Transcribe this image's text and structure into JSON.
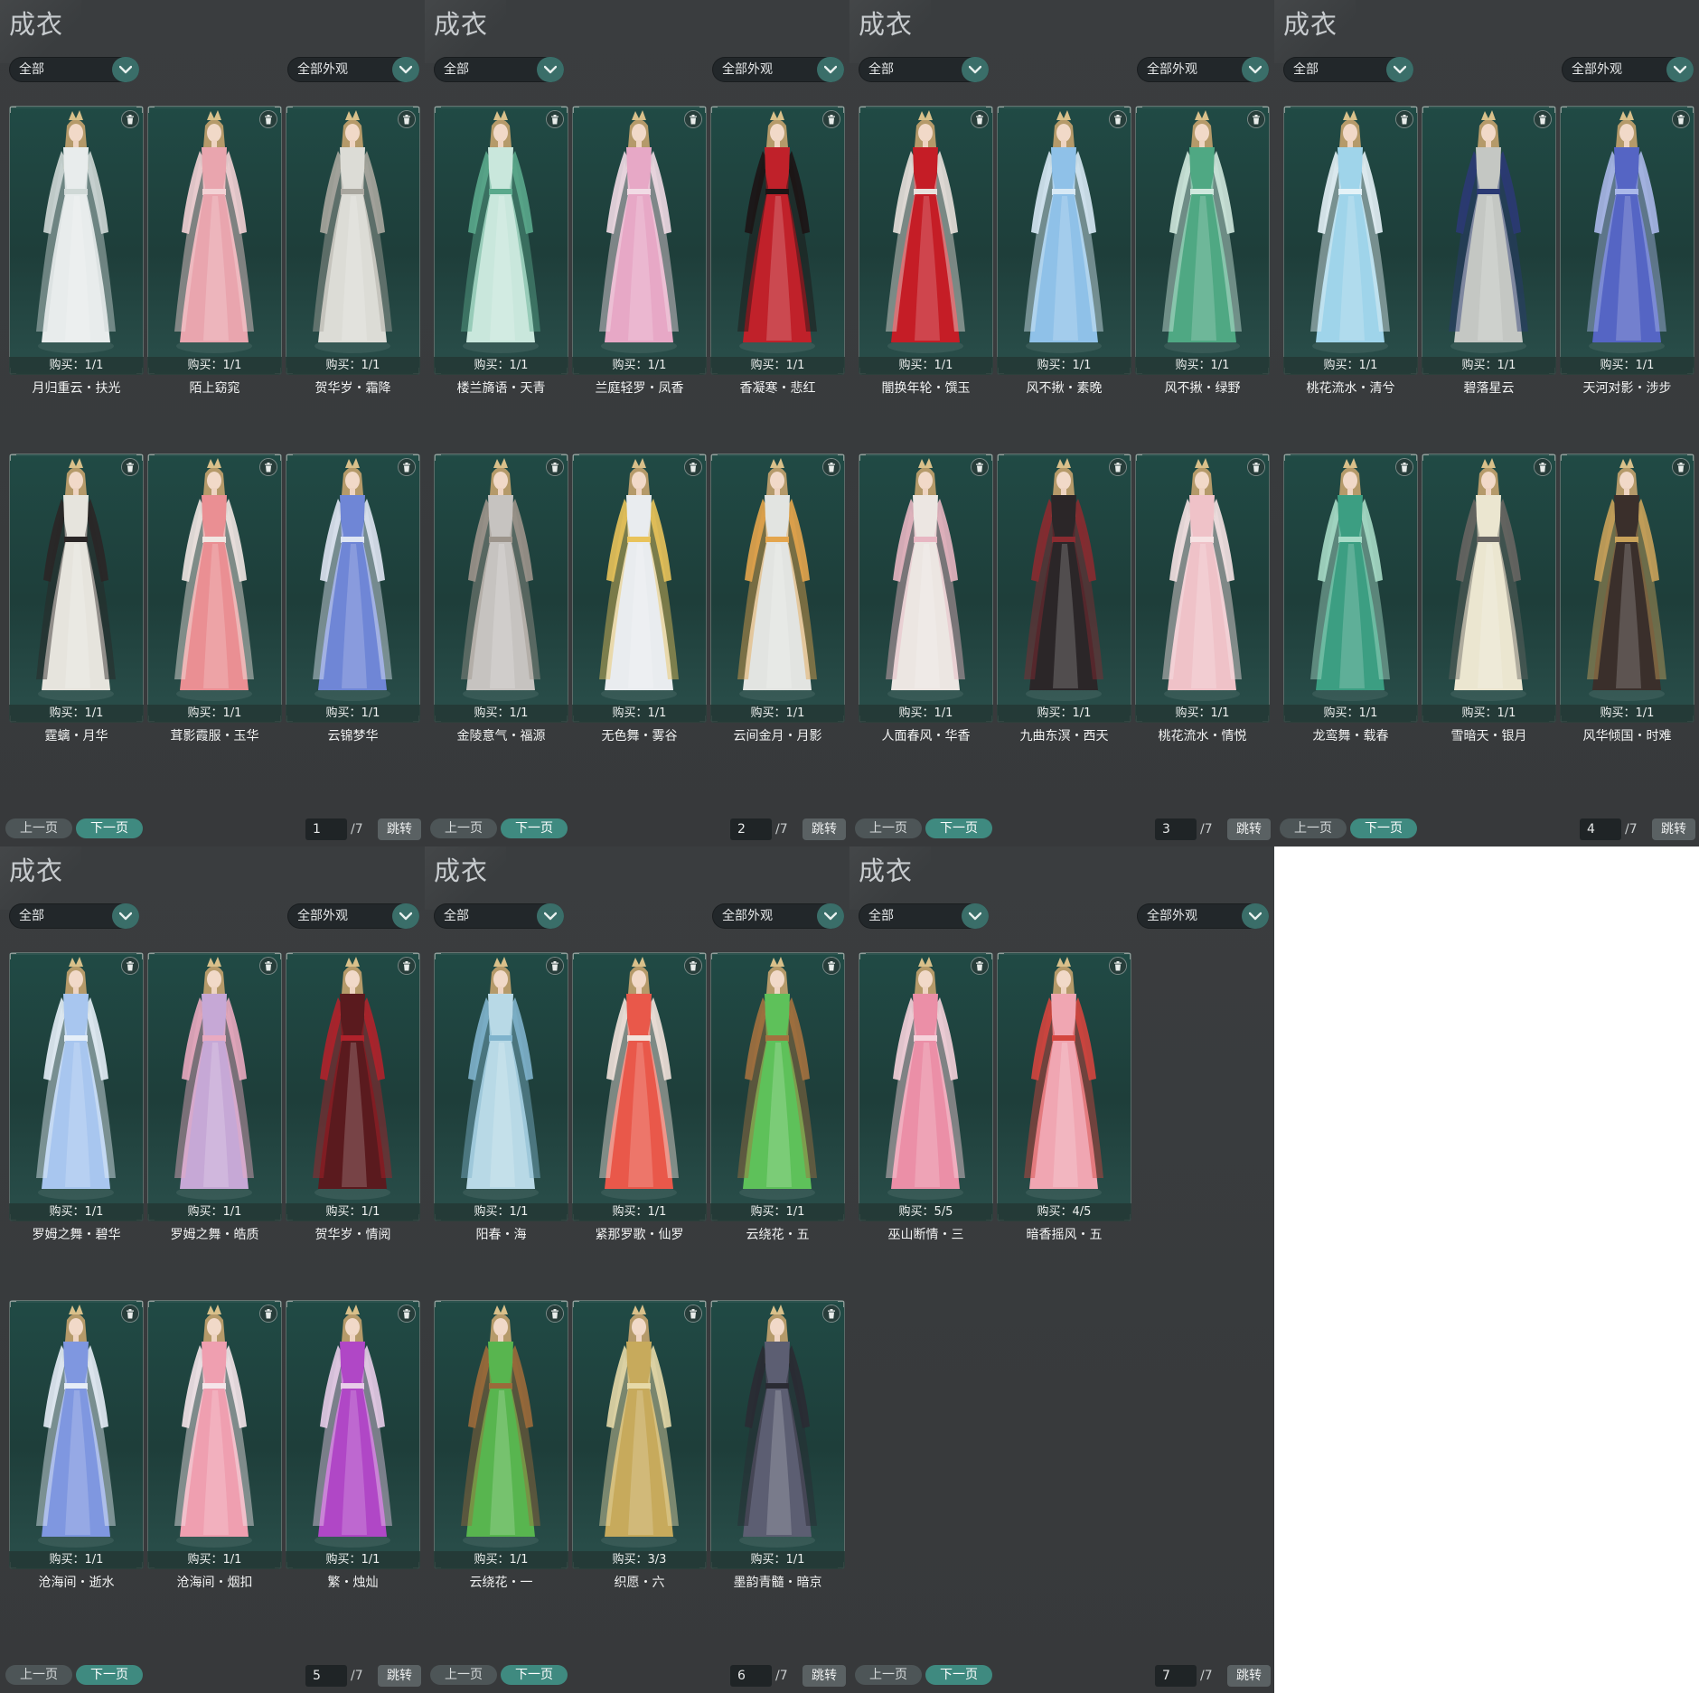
{
  "colors": {
    "panel_bg": "#3a3d3f",
    "card_bg": "#204a45",
    "accent": "#3f8a80",
    "dropdown_bg": "#22272a"
  },
  "panels": [
    {
      "title": "成衣",
      "filter1": "全部",
      "filter2": "全部外观",
      "prev_label": "上一页",
      "next_label": "下一页",
      "page": "1",
      "total": "/7",
      "jump_label": "跳转",
      "items": [
        {
          "name": "月归重云・扶光",
          "buy": "购买：1/1",
          "dress": "#e8ecec",
          "accent": "#cfd8d6"
        },
        {
          "name": "陌上窈窕",
          "buy": "购买：1/1",
          "dress": "#e9a5ae",
          "accent": "#f3d2d5"
        },
        {
          "name": "贺华岁・霜降",
          "buy": "购买：1/1",
          "dress": "#dcdcd6",
          "accent": "#a9a79f"
        },
        {
          "name": "霆螭・月华",
          "buy": "购买：1/1",
          "dress": "#e6e4dd",
          "accent": "#2a2626"
        },
        {
          "name": "茸影霞服・玉华",
          "buy": "购买：1/1",
          "dress": "#ea8f93",
          "accent": "#f1e7e3"
        },
        {
          "name": "云锦梦华",
          "buy": "购买：1/1",
          "dress": "#6f86d6",
          "accent": "#dfe6f3"
        }
      ]
    },
    {
      "title": "成衣",
      "filter1": "全部",
      "filter2": "全部外观",
      "prev_label": "上一页",
      "next_label": "下一页",
      "page": "2",
      "total": "/7",
      "jump_label": "跳转",
      "items": [
        {
          "name": "楼兰旖语・天青",
          "buy": "购买：1/1",
          "dress": "#c9e7dc",
          "accent": "#5aa98c"
        },
        {
          "name": "兰庭轻罗・凤香",
          "buy": "购买：1/1",
          "dress": "#e7a8c6",
          "accent": "#f1dbe5"
        },
        {
          "name": "香凝寒・悲红",
          "buy": "购买：1/1",
          "dress": "#c0212a",
          "accent": "#1c1415"
        },
        {
          "name": "金陵意气・福源",
          "buy": "购买：1/1",
          "dress": "#c6c3c0",
          "accent": "#9c948b"
        },
        {
          "name": "无色舞・雾谷",
          "buy": "购买：1/1",
          "dress": "#e9ecef",
          "accent": "#e9c35a"
        },
        {
          "name": "云间金月・月影",
          "buy": "购买：1/1",
          "dress": "#e2e4e1",
          "accent": "#e4a54c"
        }
      ]
    },
    {
      "title": "成衣",
      "filter1": "全部",
      "filter2": "全部外观",
      "prev_label": "上一页",
      "next_label": "下一页",
      "page": "3",
      "total": "/7",
      "jump_label": "跳转",
      "items": [
        {
          "name": "闇换年轮・馔玉",
          "buy": "购买：1/1",
          "dress": "#c51d26",
          "accent": "#e8e1dc"
        },
        {
          "name": "风不揪・素晚",
          "buy": "购买：1/1",
          "dress": "#8fc1e8",
          "accent": "#d7e9f5"
        },
        {
          "name": "风不揪・绿野",
          "buy": "购买：1/1",
          "dress": "#4fa883",
          "accent": "#cfe8dd"
        },
        {
          "name": "人面春风・华香",
          "buy": "购买：1/1",
          "dress": "#ece6e2",
          "accent": "#e7b6c2"
        },
        {
          "name": "九曲东溟・西天",
          "buy": "购买：1/1",
          "dress": "#2b2628",
          "accent": "#8a2b30"
        },
        {
          "name": "桃花流水・情悦",
          "buy": "购买：1/1",
          "dress": "#efc2c8",
          "accent": "#f6e3e4"
        }
      ]
    },
    {
      "title": "成衣",
      "filter1": "全部",
      "filter2": "全部外观",
      "prev_label": "上一页",
      "next_label": "下一页",
      "page": "4",
      "total": "/7",
      "jump_label": "跳转",
      "items": [
        {
          "name": "桃花流水・清兮",
          "buy": "购买：1/1",
          "dress": "#9fd4ea",
          "accent": "#e4f2f7"
        },
        {
          "name": "碧落星云",
          "buy": "购买：1/1",
          "dress": "#c4c7c3",
          "accent": "#2b3a74"
        },
        {
          "name": "天河对影・涉步",
          "buy": "购买：1/1",
          "dress": "#5565c4",
          "accent": "#aab8e9"
        },
        {
          "name": "龙鸾舞・载春",
          "buy": "购买：1/1",
          "dress": "#3c9e82",
          "accent": "#a7dbc7"
        },
        {
          "name": "雪暗天・银月",
          "buy": "购买：1/1",
          "dress": "#ebe6d0",
          "accent": "#676562"
        },
        {
          "name": "风华倾国・时难",
          "buy": "购买：1/1",
          "dress": "#3a2f2b",
          "accent": "#c9a25a"
        }
      ]
    },
    {
      "title": "成衣",
      "filter1": "全部",
      "filter2": "全部外观",
      "prev_label": "上一页",
      "next_label": "下一页",
      "page": "5",
      "total": "/7",
      "jump_label": "跳转",
      "items": [
        {
          "name": "罗姆之舞・碧华",
          "buy": "购买：1/1",
          "dress": "#a8c6ef",
          "accent": "#e6eff8"
        },
        {
          "name": "罗姆之舞・皓质",
          "buy": "购买：1/1",
          "dress": "#c6a8d6",
          "accent": "#e9aac0"
        },
        {
          "name": "贺华岁・情阅",
          "buy": "购买：1/1",
          "dress": "#5a1a1e",
          "accent": "#b0222b"
        },
        {
          "name": "沧海间・逝水",
          "buy": "购买：1/1",
          "dress": "#7f97e0",
          "accent": "#e6edf7"
        },
        {
          "name": "沧海间・烟扣",
          "buy": "购买：1/1",
          "dress": "#ef9fb0",
          "accent": "#f5e6ea"
        },
        {
          "name": "繁・烛灿",
          "buy": "购买：1/1",
          "dress": "#b047c6",
          "accent": "#e8cde9"
        }
      ]
    },
    {
      "title": "成衣",
      "filter1": "全部",
      "filter2": "全部外观",
      "prev_label": "上一页",
      "next_label": "下一页",
      "page": "6",
      "total": "/7",
      "jump_label": "跳转",
      "items": [
        {
          "name": "阳春・海",
          "buy": "购买：1/1",
          "dress": "#b8d9e6",
          "accent": "#7fb3cc"
        },
        {
          "name": "紧那罗歌・仙罗",
          "buy": "购买：1/1",
          "dress": "#e9584a",
          "accent": "#f2e3dc"
        },
        {
          "name": "云绕花・五",
          "buy": "购买：1/1",
          "dress": "#5ec15a",
          "accent": "#a3713f"
        },
        {
          "name": "云绕花・一",
          "buy": "购买：1/1",
          "dress": "#58b54f",
          "accent": "#9b6a3a"
        },
        {
          "name": "织愿・六",
          "buy": "购买：3/3",
          "dress": "#c7aa5c",
          "accent": "#e6d9a8"
        },
        {
          "name": "墨韵青髓・暗京",
          "buy": "购买：1/1",
          "dress": "#5c5e72",
          "accent": "#2a2b33"
        }
      ]
    },
    {
      "title": "成衣",
      "filter1": "全部",
      "filter2": "全部外观",
      "prev_label": "上一页",
      "next_label": "下一页",
      "page": "7",
      "total": "/7",
      "jump_label": "跳转",
      "items": [
        {
          "name": "巫山断情・三",
          "buy": "购买：5/5",
          "dress": "#eb8fa7",
          "accent": "#f6d3dc"
        },
        {
          "name": "暗香摇风・五",
          "buy": "购买：4/5",
          "dress": "#f0a6b2",
          "accent": "#d3453e"
        }
      ]
    }
  ]
}
